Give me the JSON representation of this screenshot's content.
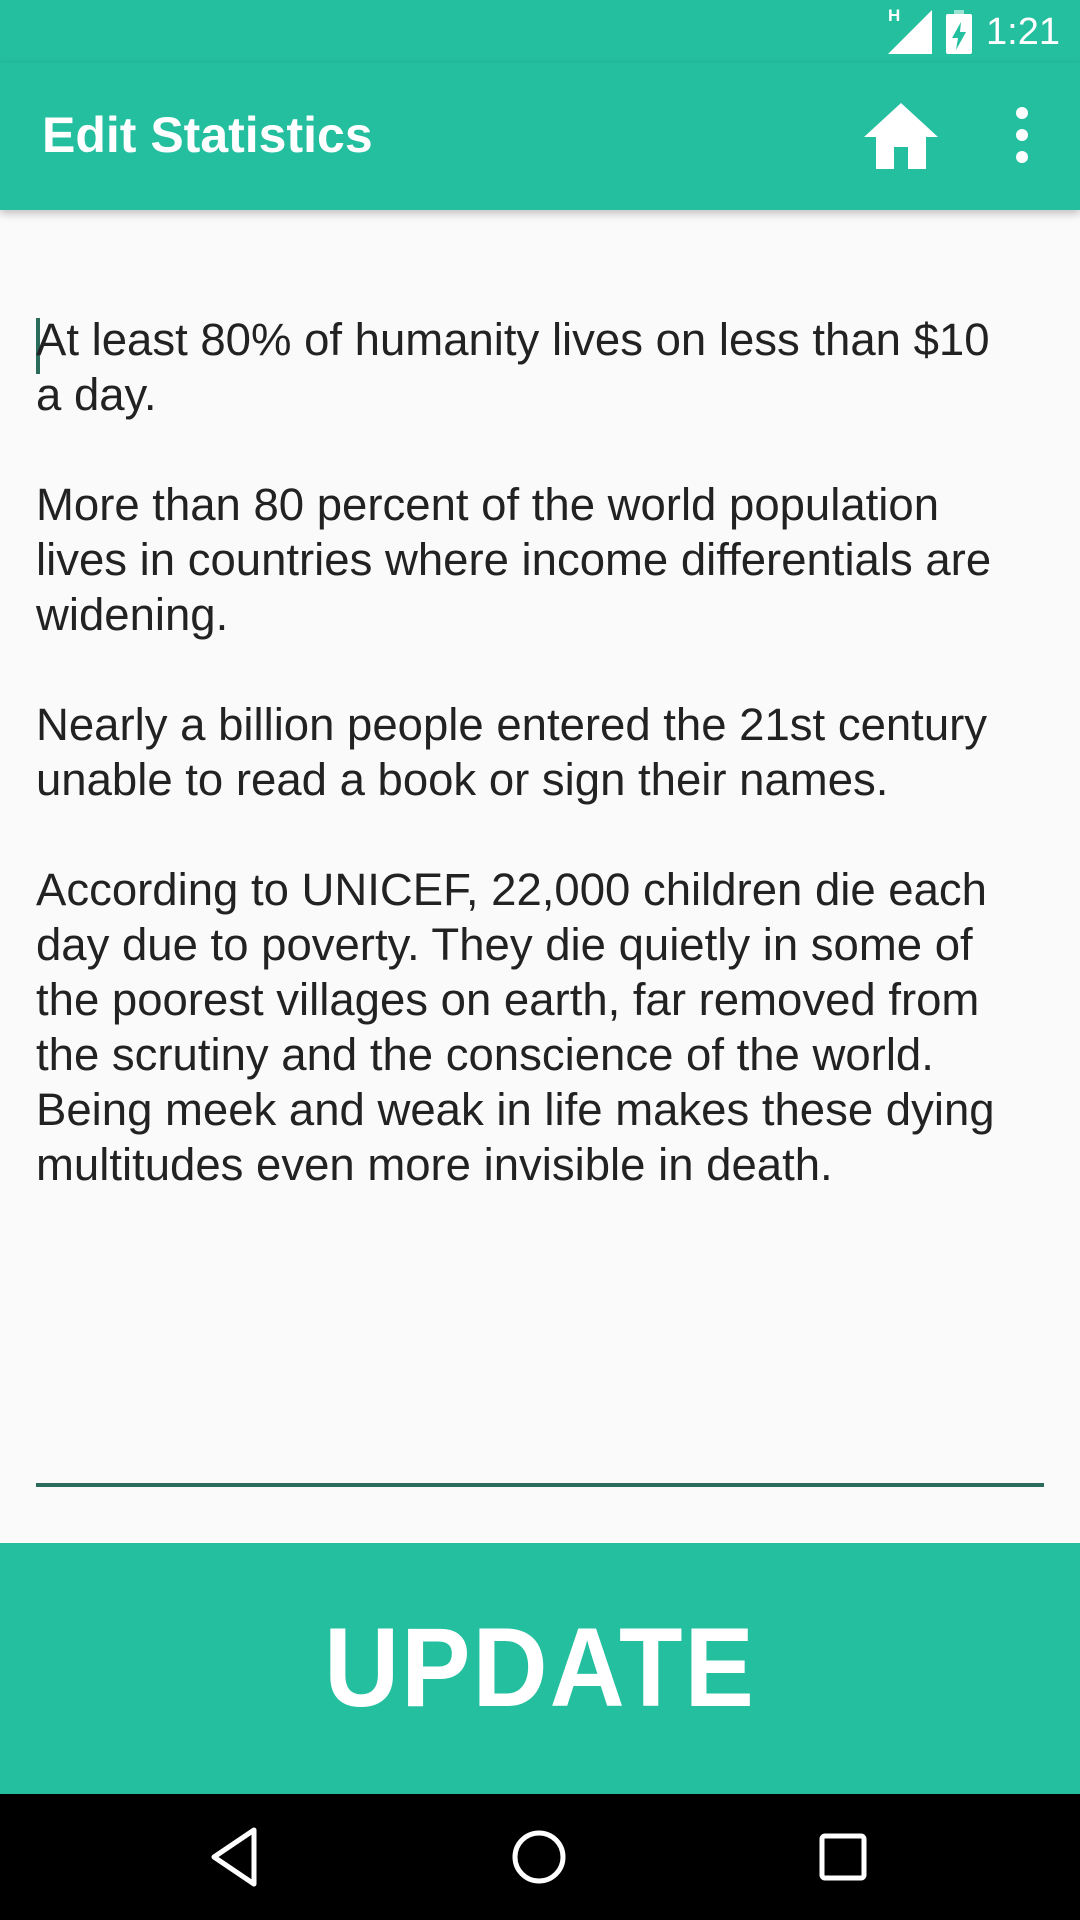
{
  "status_bar": {
    "time": "1:21",
    "network_label": "H",
    "icons": [
      "signal-icon",
      "battery-charging-icon"
    ]
  },
  "app_bar": {
    "title": "Edit Statistics",
    "home_icon": "home-icon",
    "menu_icon": "more-vert-icon"
  },
  "editor": {
    "value": "At least 80% of humanity lives on less than $10\na day.\n\nMore than 80 percent of the world population\nlives in countries where income differentials are\nwidening.\n\nNearly a billion people entered the 21st century\nunable to read a book or sign their names.\n\nAccording to UNICEF, 22,000 children die each\nday due to poverty. They die quietly in some of\nthe poorest villages on earth, far removed from\nthe scrutiny and the conscience of the world.\nBeing meek and weak in life makes these dying\nmultitudes even more invisible in death.",
    "accent_color": "#2a6b5c"
  },
  "update_button": {
    "label": "UPDATE"
  },
  "nav_bar": {
    "icons": [
      "back-icon",
      "home-circle-icon",
      "recents-icon"
    ]
  },
  "colors": {
    "primary": "#23bf9f",
    "background": "#fafafa",
    "text": "#222222"
  }
}
